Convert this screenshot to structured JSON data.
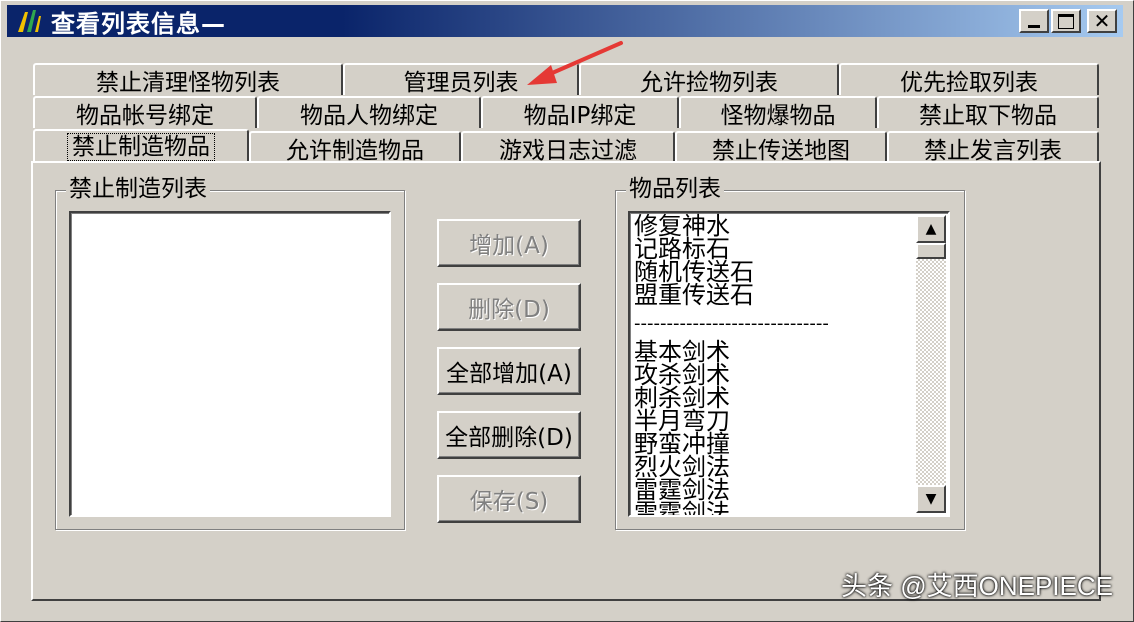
{
  "window": {
    "title": "查看列表信息—",
    "buttons": {
      "minimize": "_",
      "maximize": "□",
      "close": "X"
    }
  },
  "tabs": {
    "row1": [
      "禁止清理怪物列表",
      "管理员列表",
      "允许捡物列表",
      "优先捡取列表"
    ],
    "row2": [
      "物品帐号绑定",
      "物品人物绑定",
      "物品IP绑定",
      "怪物爆物品",
      "禁止取下物品"
    ],
    "row3": [
      "禁止制造物品",
      "允许制造物品",
      "游戏日志过滤",
      "禁止传送地图",
      "禁止发言列表"
    ],
    "active": "禁止制造物品"
  },
  "left_group": {
    "title": "禁止制造列表",
    "items": []
  },
  "buttons": {
    "add": "增加(A)",
    "delete": "删除(D)",
    "add_all": "全部增加(A)",
    "delete_all": "全部删除(D)",
    "save": "保存(S)"
  },
  "right_group": {
    "title": "物品列表",
    "items": [
      "修复神水",
      "记路标石",
      "随机传送石",
      "盟重传送石",
      "------------------------------",
      "基本剑术",
      "攻杀剑术",
      "刺杀剑术",
      "半月弯刀",
      "野蛮冲撞",
      "烈火剑法",
      "雷霆剑法",
      "雷霆剑法"
    ]
  },
  "watermark": "头条 @艾西ONEPIECE",
  "colors": {
    "title_start": "#0a246a",
    "title_end": "#a6caf0",
    "face": "#d4d0c8",
    "arrow": "#e53935"
  }
}
